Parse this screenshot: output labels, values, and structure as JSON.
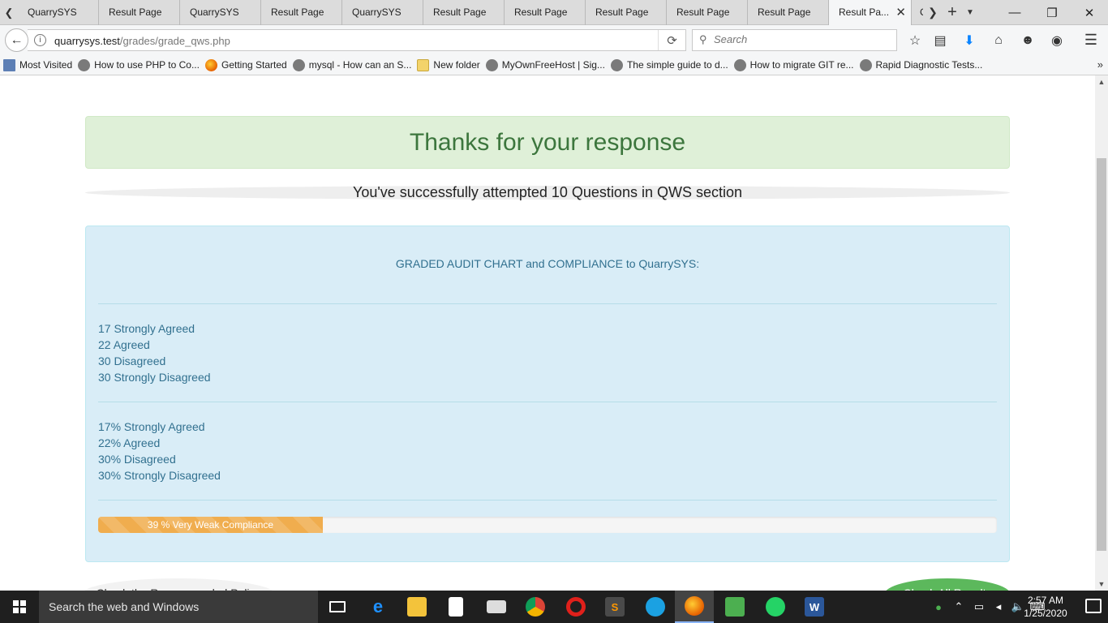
{
  "browser": {
    "tabs": [
      {
        "label": "QuarrySYS"
      },
      {
        "label": "Result Page"
      },
      {
        "label": "QuarrySYS"
      },
      {
        "label": "Result Page"
      },
      {
        "label": "QuarrySYS"
      },
      {
        "label": "Result Page"
      },
      {
        "label": "Result Page"
      },
      {
        "label": "Result Page"
      },
      {
        "label": "Result Page"
      },
      {
        "label": "Result Page"
      },
      {
        "label": "Result Pa..."
      }
    ],
    "partial_tab_label": "C",
    "url_host": "quarrysys.test",
    "url_path": "/grades/grade_qws.php",
    "search_placeholder": "Search",
    "bookmarks": [
      {
        "label": "Most Visited",
        "icon": "page-icon"
      },
      {
        "label": "How to use PHP to Co...",
        "icon": "globe-icon"
      },
      {
        "label": "Getting Started",
        "icon": "firefox-icon"
      },
      {
        "label": "mysql - How can an S...",
        "icon": "globe-icon"
      },
      {
        "label": "New folder",
        "icon": "folder-icon"
      },
      {
        "label": "MyOwnFreeHost | Sig...",
        "icon": "globe-icon"
      },
      {
        "label": "The simple guide to d...",
        "icon": "globe-icon"
      },
      {
        "label": "How to migrate GIT re...",
        "icon": "globe-icon"
      },
      {
        "label": "Rapid Diagnostic Tests...",
        "icon": "globe-icon"
      }
    ]
  },
  "page": {
    "heading": "Thanks for your response",
    "attempt_message": "You've successfully attempted 10 Questions in QWS section",
    "chart_title": "GRADED AUDIT CHART and COMPLIANCE to QuarrySYS:",
    "counts": [
      "17 Strongly Agreed",
      "22 Agreed",
      "30 Disagreed",
      "30 Strongly Disagreed"
    ],
    "percentages": [
      "17% Strongly Agreed",
      "22% Agreed",
      "30% Disagreed",
      "30% Strongly Disagreed"
    ],
    "compliance": {
      "label": "39 % Very Weak Compliance",
      "percent": 25,
      "color": "#f0ad4e"
    },
    "bottom_left_button": "Check the Recommended Policy",
    "bottom_right_button": "Check All Results"
  },
  "taskbar": {
    "search_placeholder": "Search the web and Windows",
    "time": "2:57 AM",
    "date": "1/25/2020"
  }
}
